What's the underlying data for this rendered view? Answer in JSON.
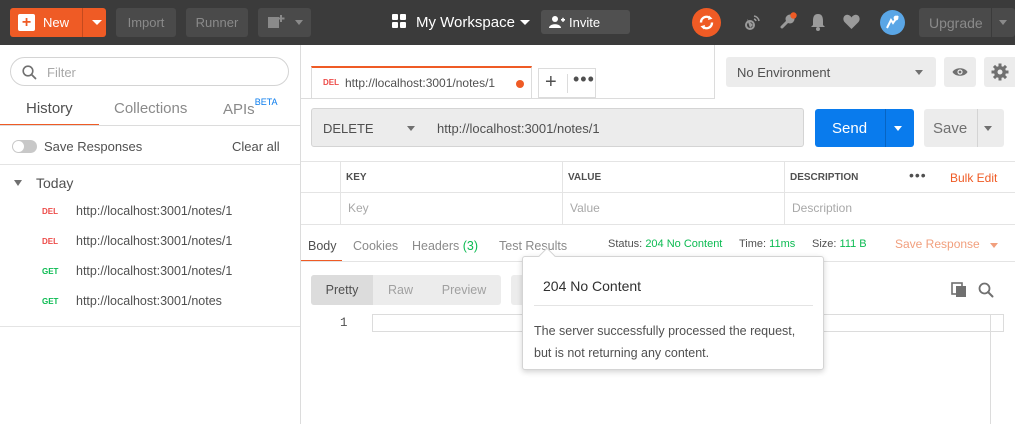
{
  "topbar": {
    "new_label": "New",
    "import_label": "Import",
    "runner_label": "Runner",
    "workspace_title": "My Workspace",
    "invite_label": "Invite",
    "upgrade_label": "Upgrade",
    "accent": "#ef5b25",
    "icons": [
      "plus-icon",
      "new-window-icon",
      "grid-icon",
      "add-user-icon",
      "sync-icon",
      "satellite-icon",
      "wrench-icon",
      "bell-icon",
      "heart-icon",
      "avatar-icon"
    ]
  },
  "sidebar": {
    "filter_placeholder": "Filter",
    "tabs": [
      {
        "label": "History"
      },
      {
        "label": "Collections"
      },
      {
        "label": "APIs",
        "badge": "BETA"
      }
    ],
    "save_responses_label": "Save Responses",
    "clear_all_label": "Clear all",
    "group_label": "Today",
    "history": [
      {
        "method": "DEL",
        "url": "http://localhost:3001/notes/1"
      },
      {
        "method": "DEL",
        "url": "http://localhost:3001/notes/1"
      },
      {
        "method": "GET",
        "url": "http://localhost:3001/notes/1"
      },
      {
        "method": "GET",
        "url": "http://localhost:3001/notes"
      }
    ]
  },
  "request_tab": {
    "method": "DEL",
    "url": "http://localhost:3001/notes/1"
  },
  "environment": {
    "selected": "No Environment"
  },
  "request": {
    "method": "DELETE",
    "url": "http://localhost:3001/notes/1",
    "send_label": "Send",
    "save_label": "Save"
  },
  "params": {
    "headers": [
      "KEY",
      "VALUE",
      "DESCRIPTION"
    ],
    "placeholders": [
      "Key",
      "Value",
      "Description"
    ],
    "bulk_edit_label": "Bulk Edit"
  },
  "response": {
    "tabs": [
      {
        "label": "Body"
      },
      {
        "label": "Cookies"
      },
      {
        "label": "Headers",
        "count": "(3)"
      },
      {
        "label": "Test Results"
      }
    ],
    "status_label": "Status:",
    "status_value": "204 No Content",
    "time_label": "Time:",
    "time_value": "11ms",
    "size_label": "Size:",
    "size_value": "111 B",
    "save_response_label": "Save Response",
    "view_options": [
      "Pretty",
      "Raw",
      "Preview"
    ],
    "line_number": "1"
  },
  "tooltip": {
    "title": "204 No Content",
    "description": "The server successfully processed the request, but is not returning any content."
  }
}
